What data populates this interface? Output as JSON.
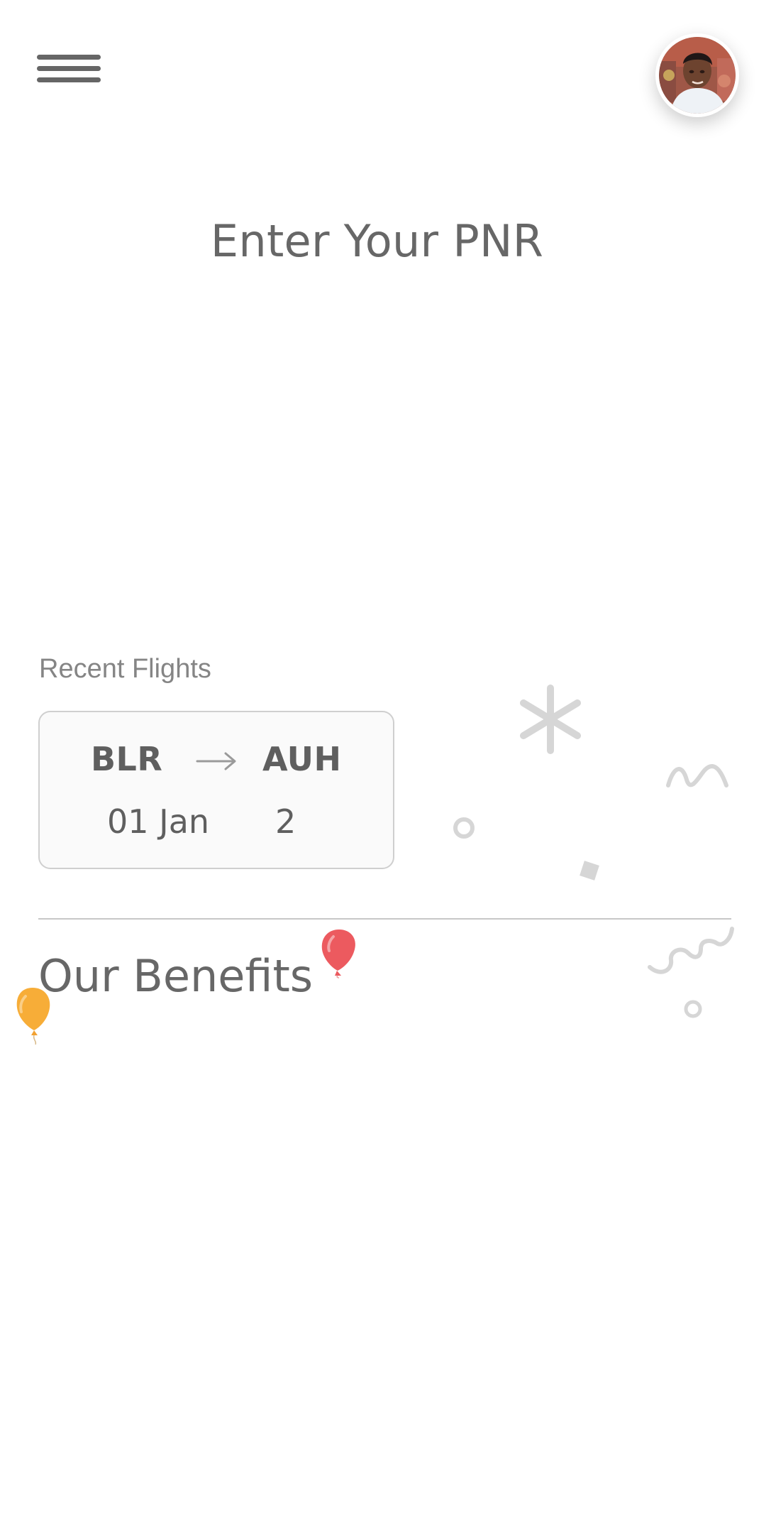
{
  "header": {
    "menu_icon": "hamburger-menu-icon",
    "avatar_icon": "user-avatar-icon"
  },
  "main": {
    "title": "Enter Your PNR",
    "recent_flights_label": "Recent Flights",
    "recent_flights": [
      {
        "from": "BLR",
        "to": "AUH",
        "date": "01 Jan",
        "passengers": "2"
      }
    ],
    "benefits_title": "Our Benefits"
  },
  "decorations": {
    "balloon_red": "#ec5a5f",
    "balloon_orange": "#f7ad38",
    "confetti_color": "#d6d6d6"
  }
}
